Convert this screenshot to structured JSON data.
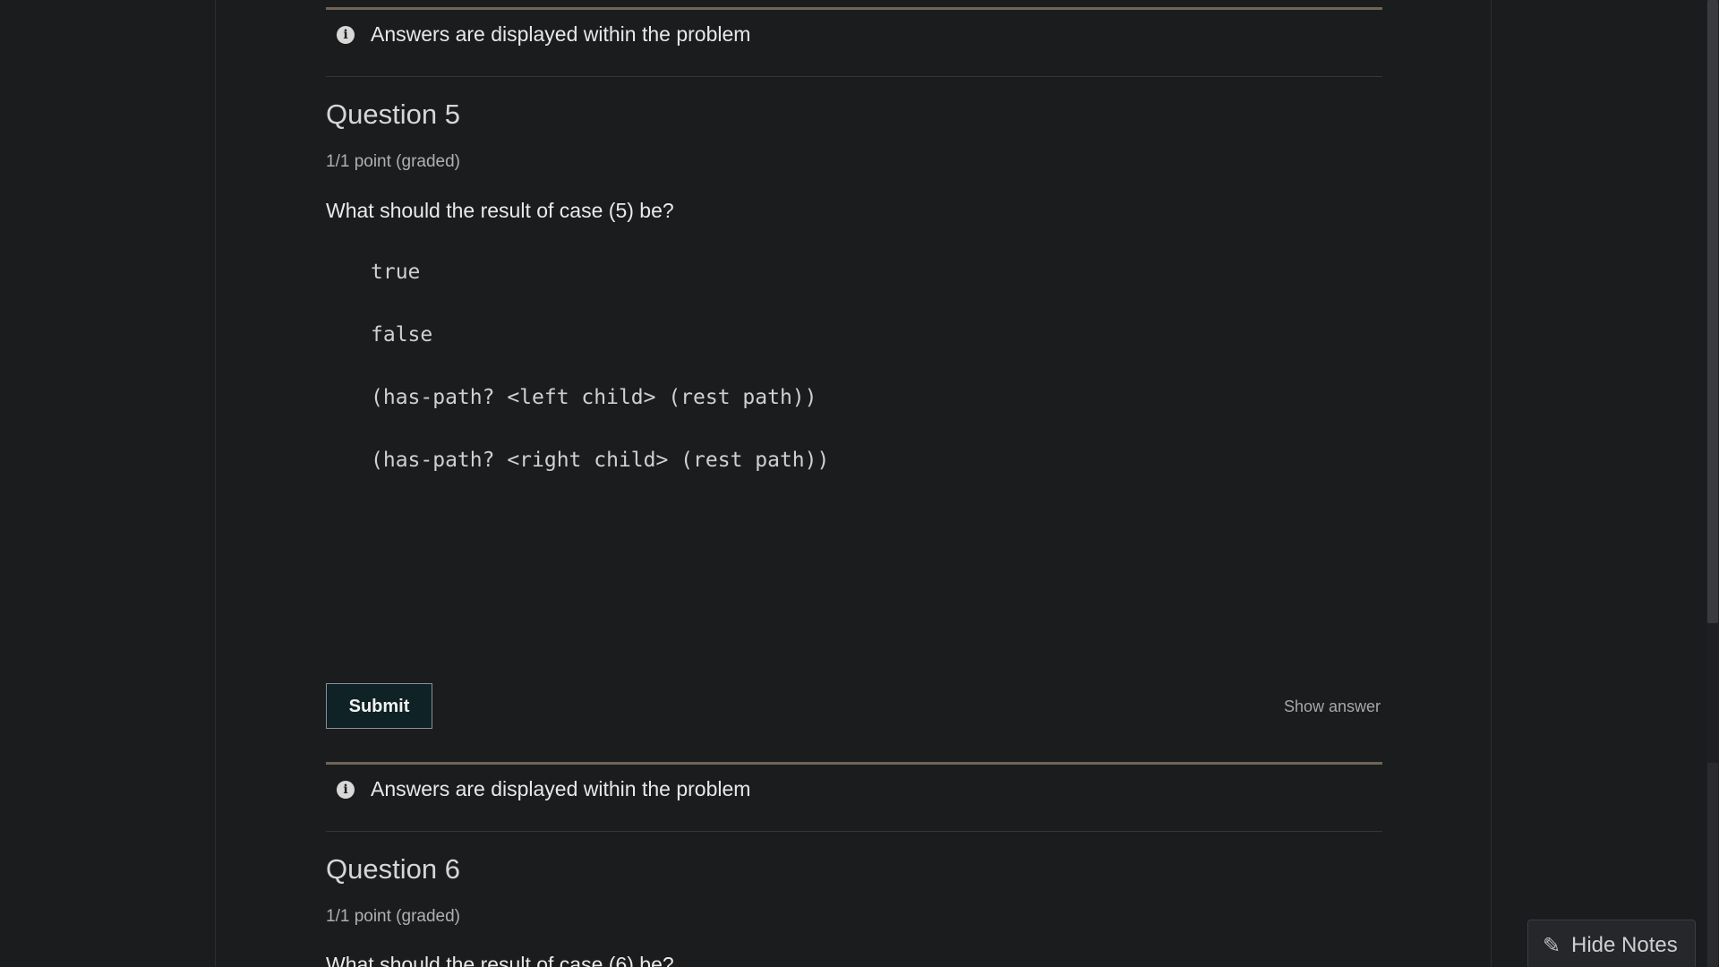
{
  "notice": {
    "text": "Answers are displayed within the problem"
  },
  "question5": {
    "title": "Question 5",
    "points": "1/1 point (graded)",
    "prompt": "What should the result of case (5) be?",
    "options": [
      "true",
      "false",
      "(has-path? <left child> (rest path))",
      "(has-path? <right child> (rest path))"
    ],
    "submit_label": "Submit",
    "show_answer_label": "Show answer"
  },
  "question6": {
    "title": "Question 6",
    "points": "1/1 point (graded)",
    "prompt": "What should the result of case (6) be?"
  },
  "notes": {
    "hide_label": "Hide Notes"
  },
  "icons": {
    "info": "info-icon",
    "pencil": "pencil-icon"
  },
  "colors": {
    "background": "#1b1c1e",
    "notice_rule": "#6e6558",
    "submit_bg": "#0f2225"
  }
}
